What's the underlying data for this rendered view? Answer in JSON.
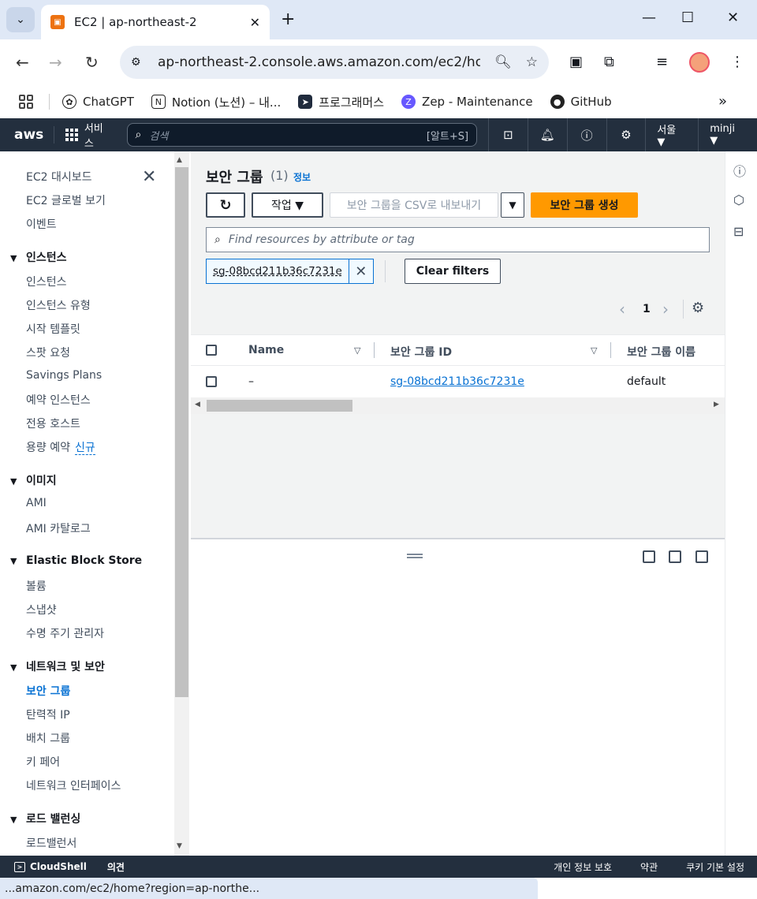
{
  "browser": {
    "tab_title": "EC2 | ap-northeast-2",
    "url": "ap-northeast-2.console.aws.amazon.com/ec2/ho...",
    "bookmarks": [
      {
        "label": "ChatGPT",
        "icon": "chatgpt-icon",
        "color": "#222222"
      },
      {
        "label": "Notion (노션) – 내...",
        "icon": "notion-icon",
        "color": "#222222"
      },
      {
        "label": "프로그래머스",
        "icon": "programmers-icon",
        "color": "#202b3d"
      },
      {
        "label": "Zep - Maintenance",
        "icon": "zep-icon",
        "color": "#6758ff"
      },
      {
        "label": "GitHub",
        "icon": "github-icon",
        "color": "#222222"
      }
    ],
    "status_url": "...amazon.com/ec2/home?region=ap-northe..."
  },
  "aws_nav": {
    "logo": "aws",
    "services": "서비스",
    "search_placeholder": "검색",
    "search_shortcut": "[알트+S]",
    "region": "서울 ▼",
    "user": "minji ▼"
  },
  "sidebar": {
    "top_items": [
      "EC2 대시보드",
      "EC2 글로벌 보기",
      "이벤트"
    ],
    "instances_section": "인스턴스",
    "instances_items": [
      "인스턴스",
      "인스턴스 유형",
      "시작 템플릿",
      "스팟 요청",
      "Savings Plans",
      "예약 인스턴스",
      "전용 호스트",
      "용량 예약"
    ],
    "new_badge": "신규",
    "images_section": "이미지",
    "images_items": [
      "AMI",
      "AMI 카탈로그"
    ],
    "ebs_section": "Elastic Block Store",
    "ebs_items": [
      "볼륨",
      "스냅샷",
      "수명 주기 관리자"
    ],
    "network_section": "네트워크 및 보안",
    "network_items": [
      "보안 그룹",
      "탄력적 IP",
      "배치 그룹",
      "키 페어",
      "네트워크 인터페이스"
    ],
    "lb_section": "로드 밸런싱",
    "lb_items": [
      "로드밸런서"
    ]
  },
  "main": {
    "title": "보안 그룹",
    "count": "(1)",
    "info": "정보",
    "actions_button": "작업 ▼",
    "export_button": "보안 그룹을 CSV로 내보내기",
    "create_button": "보안 그룹 생성",
    "search_placeholder": "Find resources by attribute or tag",
    "filter_token": "sg-08bcd211b36c7231e",
    "clear_filters": "Clear filters",
    "page_number": "1",
    "columns": [
      "Name",
      "보안 그룹 ID",
      "보안 그룹 이름"
    ],
    "rows": [
      {
        "name": "–",
        "group_id": "sg-08bcd211b36c7231e",
        "group_name": "default"
      }
    ]
  },
  "footer": {
    "cloudshell": "CloudShell",
    "feedback": "의견",
    "privacy": "개인 정보 보호",
    "terms": "약관",
    "cookies": "쿠키 기본 설정"
  },
  "colors": {
    "aws_nav_bg": "#232f3e",
    "primary_button": "#ff9900",
    "link": "#0972d3"
  }
}
